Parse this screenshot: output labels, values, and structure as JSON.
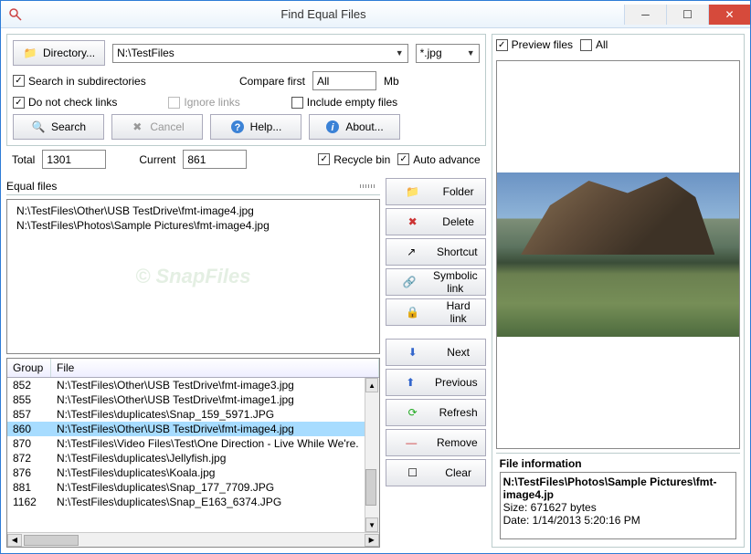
{
  "window": {
    "title": "Find Equal Files"
  },
  "toolbar": {
    "directory_btn": "Directory...",
    "directory_value": "N:\\TestFiles",
    "filter_value": "*.jpg",
    "search_subdirs": "Search in subdirectories",
    "compare_first": "Compare first",
    "compare_all": "All",
    "mb": "Mb",
    "no_check_links": "Do not check links",
    "ignore_links": "Ignore links",
    "include_empty": "Include empty files",
    "search": "Search",
    "cancel": "Cancel",
    "help": "Help...",
    "about": "About..."
  },
  "status": {
    "total_label": "Total",
    "total_value": "1301",
    "current_label": "Current",
    "current_value": "861",
    "recycle_bin": "Recycle bin",
    "auto_advance": "Auto advance"
  },
  "equal": {
    "label": "Equal files",
    "rows": [
      "N:\\TestFiles\\Other\\USB TestDrive\\fmt-image4.jpg",
      "N:\\TestFiles\\Photos\\Sample Pictures\\fmt-image4.jpg"
    ]
  },
  "actions": {
    "folder": "Folder",
    "delete": "Delete",
    "shortcut": "Shortcut",
    "symlink": "Symbolic link",
    "hardlink": "Hard link",
    "next": "Next",
    "previous": "Previous",
    "refresh": "Refresh",
    "remove": "Remove",
    "clear": "Clear"
  },
  "table": {
    "col_group": "Group",
    "col_file": "File",
    "rows": [
      {
        "group": "852",
        "file": "N:\\TestFiles\\Other\\USB TestDrive\\fmt-image3.jpg"
      },
      {
        "group": "855",
        "file": "N:\\TestFiles\\Other\\USB TestDrive\\fmt-image1.jpg"
      },
      {
        "group": "857",
        "file": "N:\\TestFiles\\duplicates\\Snap_159_5971.JPG"
      },
      {
        "group": "860",
        "file": "N:\\TestFiles\\Other\\USB TestDrive\\fmt-image4.jpg",
        "selected": true
      },
      {
        "group": "870",
        "file": "N:\\TestFiles\\Video Files\\Test\\One Direction - Live While We're."
      },
      {
        "group": "872",
        "file": "N:\\TestFiles\\duplicates\\Jellyfish.jpg"
      },
      {
        "group": "876",
        "file": "N:\\TestFiles\\duplicates\\Koala.jpg"
      },
      {
        "group": "881",
        "file": "N:\\TestFiles\\duplicates\\Snap_177_7709.JPG"
      },
      {
        "group": "1162",
        "file": "N:\\TestFiles\\duplicates\\Snap_E163_6374.JPG"
      }
    ]
  },
  "preview": {
    "preview_files": "Preview files",
    "all": "All",
    "fileinfo_label": "File information",
    "fileinfo_name": "N:\\TestFiles\\Photos\\Sample Pictures\\fmt-image4.jp",
    "fileinfo_size": "Size: 671627 bytes",
    "fileinfo_date": "Date: 1/14/2013 5:20:16 PM"
  }
}
